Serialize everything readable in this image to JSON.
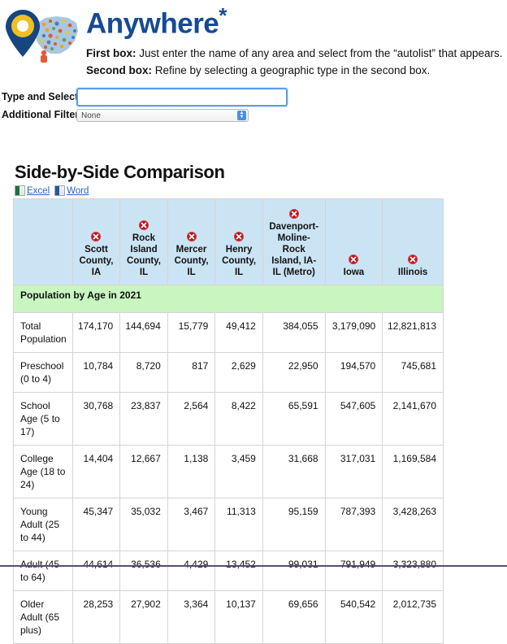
{
  "header": {
    "title": "Anywhere",
    "title_star": "*",
    "logo_icon": "map-pin-usa-icon",
    "instructions": [
      {
        "label": "First box:",
        "text": " Just enter the name of any area and select from the “autolist” that appears."
      },
      {
        "label": "Second box:",
        "text": " Refine by selecting a geographic type in the second box."
      }
    ]
  },
  "form": {
    "type_and_select_label": "Type and Select:",
    "type_and_select_value": "",
    "type_and_select_placeholder": "",
    "additional_filter_label": "Additional Filter:",
    "additional_filter_value": "None",
    "additional_filter_options": [
      "None"
    ]
  },
  "comparison": {
    "title": "Side-by-Side Comparison",
    "exports": [
      {
        "label": "Excel",
        "icon": "excel-file-icon"
      },
      {
        "label": "Word",
        "icon": "word-file-icon"
      }
    ],
    "columns": [
      {
        "name": "",
        "removable": false
      },
      {
        "name": "Scott County, IA",
        "removable": true
      },
      {
        "name": "Rock Island County, IL",
        "removable": true
      },
      {
        "name": "Mercer County, IL",
        "removable": true
      },
      {
        "name": "Henry County, IL",
        "removable": true
      },
      {
        "name": "Davenport-Moline-Rock Island, IA-IL (Metro)",
        "removable": true
      },
      {
        "name": "Iowa",
        "removable": true
      },
      {
        "name": "Illinois",
        "removable": true
      }
    ],
    "section_title": "Population by Age in 2021",
    "rows": [
      {
        "label": "Total Population",
        "values": [
          "174,170",
          "144,694",
          "15,779",
          "49,412",
          "384,055",
          "3,179,090",
          "12,821,813"
        ]
      },
      {
        "label": "Preschool (0 to 4)",
        "values": [
          "10,784",
          "8,720",
          "817",
          "2,629",
          "22,950",
          "194,570",
          "745,681"
        ]
      },
      {
        "label": "School Age (5 to 17)",
        "values": [
          "30,768",
          "23,837",
          "2,564",
          "8,422",
          "65,591",
          "547,605",
          "2,141,670"
        ]
      },
      {
        "label": "College Age (18 to 24)",
        "values": [
          "14,404",
          "12,667",
          "1,138",
          "3,459",
          "31,668",
          "317,031",
          "1,169,584"
        ]
      },
      {
        "label": "Young Adult (25 to 44)",
        "values": [
          "45,347",
          "35,032",
          "3,467",
          "11,313",
          "95,159",
          "787,393",
          "3,428,263"
        ]
      },
      {
        "label": "Adult (45 to 64)",
        "values": [
          "44,614",
          "36,536",
          "4,429",
          "13,452",
          "99,031",
          "791,949",
          "3,323,880"
        ]
      },
      {
        "label": "Older Adult (65 plus)",
        "values": [
          "28,253",
          "27,902",
          "3,364",
          "10,137",
          "69,656",
          "540,542",
          "2,012,735"
        ]
      }
    ]
  },
  "colors": {
    "title_blue": "#164a93",
    "header_blue": "#cbe4f4",
    "section_green": "#c8f5c0",
    "delete_red": "#c1151c",
    "link_blue": "#2b5fc9",
    "input_focus": "#5a9ded"
  }
}
